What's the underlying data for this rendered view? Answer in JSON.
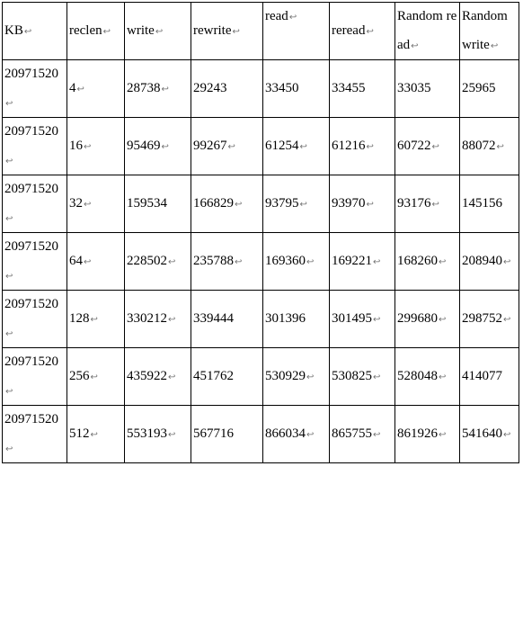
{
  "headers": [
    "KB",
    "reclen",
    "write",
    "rewrite",
    "read",
    "reread",
    "Random read",
    "Random write"
  ],
  "rows": [
    {
      "kb": "20971520",
      "reclen": "4",
      "write": "28738",
      "rewrite": "29243",
      "read": "33450",
      "reread": "33455",
      "rread": "33035",
      "rwrite": "25965"
    },
    {
      "kb": "20971520",
      "reclen": "16",
      "write": "95469",
      "rewrite": "99267",
      "read": "61254",
      "reread": "61216",
      "rread": "60722",
      "rwrite": "88072"
    },
    {
      "kb": "20971520",
      "reclen": "32",
      "write": "159534",
      "rewrite": "166829",
      "read": "93795",
      "reread": "93970",
      "rread": "93176",
      "rwrite": "145156"
    },
    {
      "kb": "20971520",
      "reclen": "64",
      "write": "228502",
      "rewrite": "235788",
      "read": "169360",
      "reread": "169221",
      "rread": "168260",
      "rwrite": "208940"
    },
    {
      "kb": "20971520",
      "reclen": "128",
      "write": "330212",
      "rewrite": "339444",
      "read": "301396",
      "reread": "301495",
      "rread": "299680",
      "rwrite": "298752"
    },
    {
      "kb": "20971520",
      "reclen": "256",
      "write": "435922",
      "rewrite": "451762",
      "read": "530929",
      "reread": "530825",
      "rread": "528048",
      "rwrite": "414077"
    },
    {
      "kb": "20971520",
      "reclen": "512",
      "write": "553193",
      "rewrite": "567716",
      "read": "866034",
      "reread": "865755",
      "rread": "861926",
      "rwrite": "541640"
    }
  ]
}
